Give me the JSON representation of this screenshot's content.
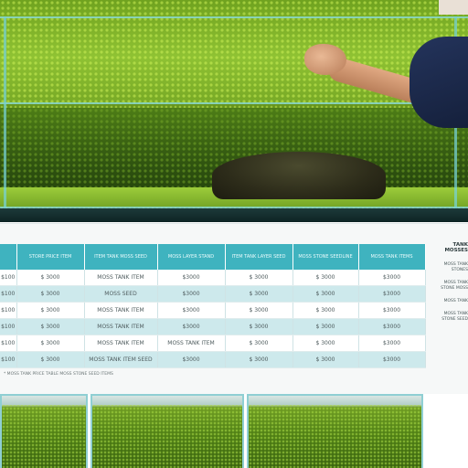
{
  "hero": {
    "scene": [
      "planted-aquarium",
      "hand-trimming-moss",
      "stone-mound"
    ]
  },
  "table": {
    "headers": [
      "",
      "STORE PRICE ITEM",
      "ITEM TANK MOSS SEED",
      "MOSS LAYER STAND",
      "ITEM TANK LAYER SEED",
      "MOSS STONE SEEDLINE",
      "MOSS TANK ITEMS"
    ],
    "rows": [
      [
        "$100",
        "$ 3000",
        "MOSS TANK ITEM",
        "$3000",
        "$ 3000",
        "$ 3000",
        "$3000"
      ],
      [
        "$100",
        "$ 3000",
        "MOSS SEED",
        "$3000",
        "$ 3000",
        "$ 3000",
        "$3000"
      ],
      [
        "$100",
        "$ 3000",
        "MOSS TANK ITEM",
        "$3000",
        "$ 3000",
        "$ 3000",
        "$3000"
      ],
      [
        "$100",
        "$ 3000",
        "MOSS TANK ITEM",
        "$3000",
        "$ 3000",
        "$ 3000",
        "$3000"
      ],
      [
        "$100",
        "$ 3000",
        "MOSS TANK ITEM",
        "MOSS TANK ITEM",
        "$ 3000",
        "$ 3000",
        "$3000"
      ],
      [
        "$100",
        "$ 3000",
        "MOSS TANK ITEM SEED",
        "$3000",
        "$ 3000",
        "$ 3000",
        "$3000"
      ]
    ],
    "footnote": "* MOSS TANK PRICE TABLE MOSS STONE SEED ITEMS"
  },
  "side_notes": {
    "title": "TANK MOSSES",
    "items": [
      "MOSS TANK STONES",
      "MOSS TANK STONE MOSS",
      "MOSS TANK",
      "MOSS TANK STONE SEED"
    ]
  },
  "colors": {
    "header_teal": "#3fb3bf",
    "row_alt": "#cde9ec",
    "moss_green": "#6fa21f"
  }
}
